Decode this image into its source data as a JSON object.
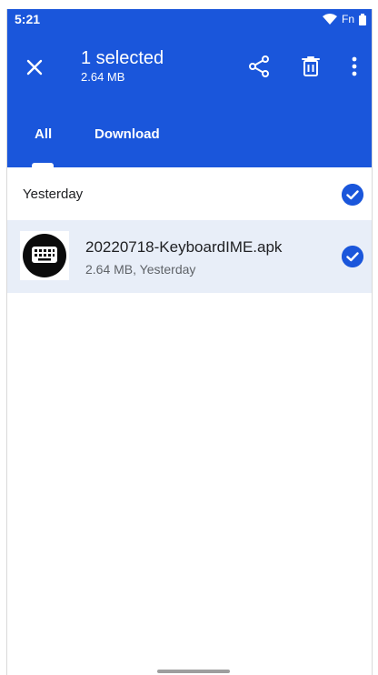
{
  "status_bar": {
    "time": "5:21",
    "carrier": "Fn"
  },
  "toolbar": {
    "selection_title": "1 selected",
    "selection_size": "2.64 MB",
    "icons": [
      "close-icon",
      "share-icon",
      "delete-icon",
      "more-vert-icon"
    ]
  },
  "tabs": [
    {
      "label": "All",
      "active": true
    },
    {
      "label": "Download",
      "active": false
    }
  ],
  "section": {
    "label": "Yesterday",
    "checked": true
  },
  "files": [
    {
      "name": "20220718-KeyboardIME.apk",
      "meta": "2.64 MB, Yesterday",
      "icon": "keyboard-icon",
      "selected": true
    }
  ],
  "colors": {
    "accent": "#1a56db",
    "selected_row": "#e8eef8"
  }
}
